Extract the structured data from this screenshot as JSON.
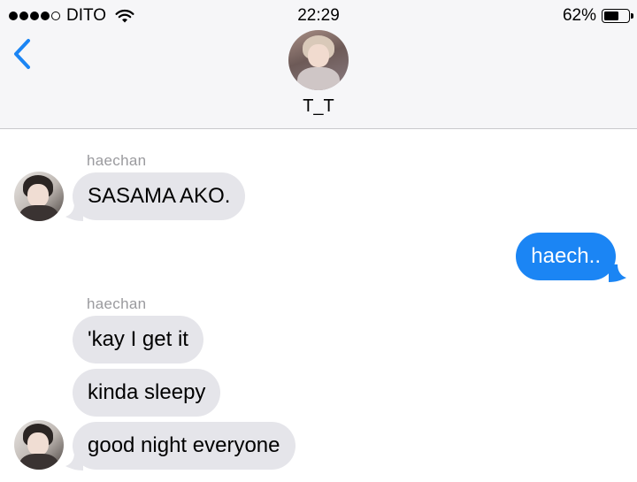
{
  "status_bar": {
    "signal_filled": 4,
    "signal_total": 5,
    "carrier": "DITO",
    "time": "22:29",
    "battery_percent": "62%",
    "battery_level": 0.62
  },
  "header": {
    "back_icon": "chevron-left-icon",
    "contact_name": "T_T"
  },
  "colors": {
    "header_bg": "#f6f6f8",
    "incoming_bubble": "#e5e5ea",
    "outgoing_bubble": "#1b85f4",
    "back_chevron": "#1b85f4",
    "sender_label": "#9a9a9e"
  },
  "messages": [
    {
      "sender": "haechan",
      "direction": "incoming",
      "text": "SASAMA AKO."
    },
    {
      "sender": "",
      "direction": "outgoing",
      "text": "haech.."
    },
    {
      "sender": "haechan",
      "direction": "incoming",
      "text": "'kay I get it"
    },
    {
      "sender": "",
      "direction": "incoming",
      "text": "kinda sleepy"
    },
    {
      "sender": "",
      "direction": "incoming",
      "text": "good night everyone"
    }
  ]
}
